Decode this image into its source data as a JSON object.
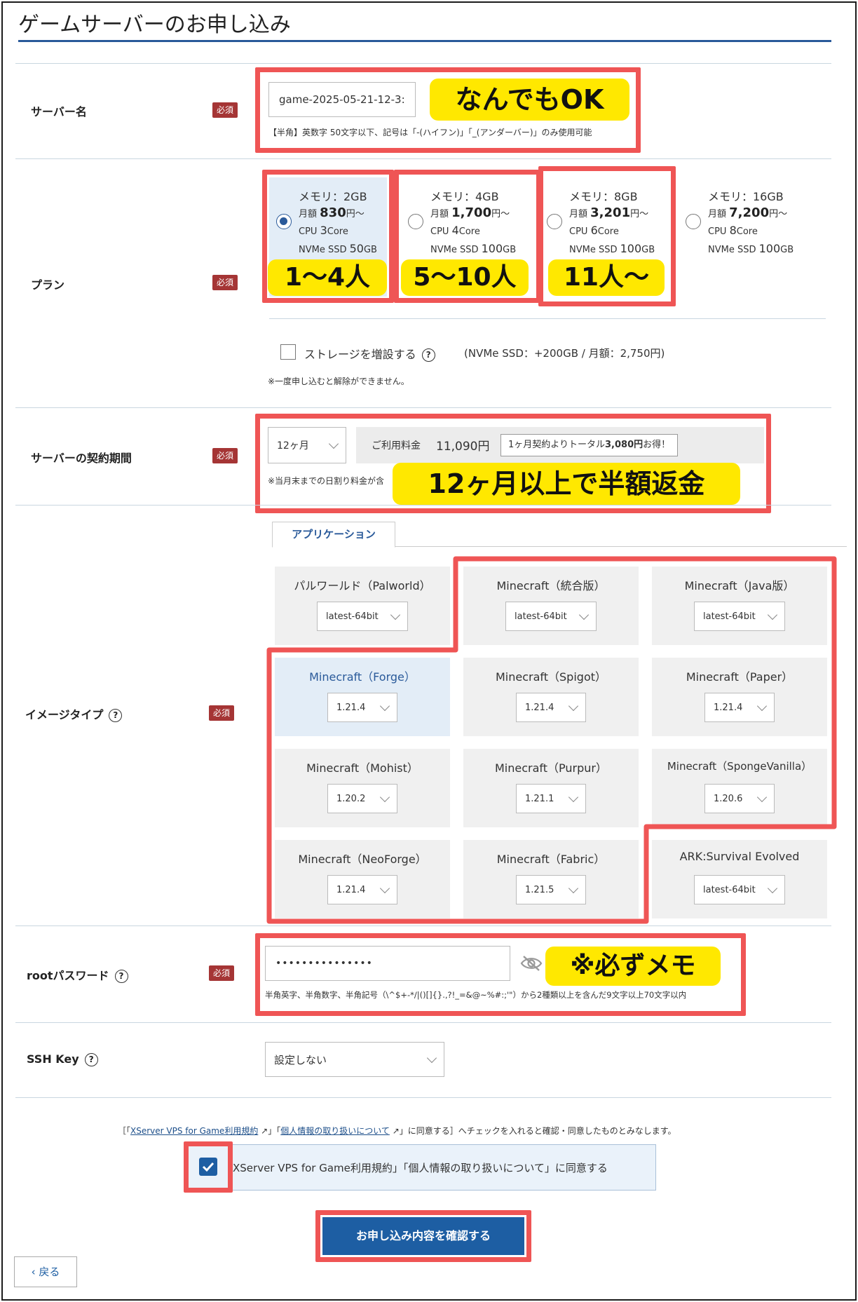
{
  "page": {
    "title": "ゲームサーバーのお申し込み"
  },
  "server_name": {
    "label": "サーバー名",
    "required": "必須",
    "value": "game-2025-05-21-12-3:",
    "hint": "【半角】英数字 50文字以下、記号は「-(ハイフン)」「_(アンダーバー)」のみ使用可能",
    "callout": "なんでもOK"
  },
  "plan": {
    "label": "プラン",
    "required": "必須",
    "options": [
      {
        "memory": "メモリ：2GB",
        "price_label": "月額",
        "price": "830",
        "price_unit": "円〜",
        "cpu_label": "CPU",
        "cpu": "3",
        "cpu_unit": "Core",
        "ssd_label": "NVMe SSD",
        "ssd": "50",
        "ssd_unit": "GB",
        "selected": true,
        "callout": "1〜4人"
      },
      {
        "memory": "メモリ：4GB",
        "price_label": "月額",
        "price": "1,700",
        "price_unit": "円〜",
        "cpu_label": "CPU",
        "cpu": "4",
        "cpu_unit": "Core",
        "ssd_label": "NVMe SSD",
        "ssd": "100",
        "ssd_unit": "GB",
        "selected": false,
        "callout": "5〜10人"
      },
      {
        "memory": "メモリ：8GB",
        "price_label": "月額",
        "price": "3,201",
        "price_unit": "円〜",
        "cpu_label": "CPU",
        "cpu": "6",
        "cpu_unit": "Core",
        "ssd_label": "NVMe SSD",
        "ssd": "100",
        "ssd_unit": "GB",
        "selected": false,
        "callout": "11人〜"
      },
      {
        "memory": "メモリ：16GB",
        "price_label": "月額",
        "price": "7,200",
        "price_unit": "円〜",
        "cpu_label": "CPU",
        "cpu": "8",
        "cpu_unit": "Core",
        "ssd_label": "NVMe SSD",
        "ssd": "100",
        "ssd_unit": "GB",
        "selected": false,
        "callout": ""
      }
    ],
    "storage_label": "ストレージを増設する",
    "storage_price": "(NVMe SSD：+200GB / 月額：2,750円)",
    "note": "※一度申し込むと解除ができません。"
  },
  "contract": {
    "label": "サーバーの契約期間",
    "required": "必須",
    "period": "12ヶ月",
    "fee_label": "ご利用料金",
    "fee": "11,090円",
    "savings_prefix": "1ヶ月契約よりトータル",
    "savings_amount": "3,080円",
    "savings_suffix": "お得！",
    "note": "※当月末までの日割り料金が含",
    "callout": "12ヶ月以上で半額返金"
  },
  "image_type": {
    "label": "イメージタイプ",
    "required": "必須",
    "tab": "アプリケーション",
    "tiles": [
      {
        "name": "パルワールド（Palworld）",
        "version": "latest-64bit"
      },
      {
        "name": "Minecraft（統合版）",
        "version": "latest-64bit"
      },
      {
        "name": "Minecraft（Java版）",
        "version": "latest-64bit"
      },
      {
        "name": "Minecraft（Forge）",
        "version": "1.21.4"
      },
      {
        "name": "Minecraft（Spigot）",
        "version": "1.21.4"
      },
      {
        "name": "Minecraft（Paper）",
        "version": "1.21.4"
      },
      {
        "name": "Minecraft（Mohist）",
        "version": "1.20.2"
      },
      {
        "name": "Minecraft（Purpur）",
        "version": "1.21.1"
      },
      {
        "name": "Minecraft（SpongeVanilla）",
        "version": "1.20.6"
      },
      {
        "name": "Minecraft（NeoForge）",
        "version": "1.21.4"
      },
      {
        "name": "Minecraft（Fabric）",
        "version": "1.21.5"
      },
      {
        "name": "ARK:Survival Evolved",
        "version": "latest-64bit"
      }
    ]
  },
  "root_password": {
    "label": "rootパスワード",
    "required": "必須",
    "value": "•••••••••••••••",
    "hint": "半角英字、半角数字、半角記号（\\^$+-*/|()[]{}.,?!_=&@~%#:;'\"）から2種類以上を含んだ9文字以上70文字以内",
    "callout": "※必ずメモ"
  },
  "ssh_key": {
    "label": "SSH Key",
    "value": "設定しない"
  },
  "agreement": {
    "notice_open": "［「",
    "terms_link": "XServer VPS for Game利用規約",
    "notice_mid": "」「",
    "privacy_link": "個人情報の取り扱いについて",
    "notice_close": "」に同意する］へチェックを入れると確認・同意したものとみなします。",
    "checkbox_label": "XServer VPS for Game利用規約」「個人情報の取り扱いについて」に同意する"
  },
  "buttons": {
    "confirm": "お申し込み内容を確認する",
    "back": "‹ 戻る"
  },
  "colors": {
    "accent": "#1d5ea3",
    "highlight_border": "#ef5555",
    "callout_bg": "#ffe800",
    "required_badge": "#a53535"
  }
}
